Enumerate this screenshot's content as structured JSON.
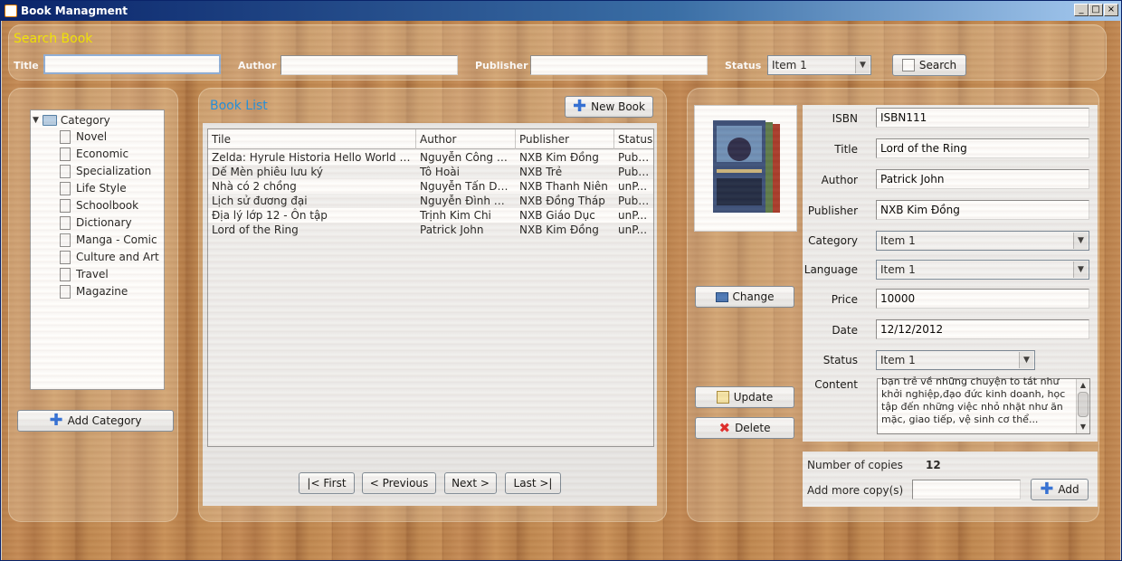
{
  "window": {
    "title": "Book Managment"
  },
  "search": {
    "heading": "Search Book",
    "title_label": "Title",
    "title_value": "",
    "author_label": "Author",
    "author_value": "",
    "publisher_label": "Publisher",
    "publisher_value": "",
    "status_label": "Status",
    "status_value": "Item 1",
    "search_button": "Search"
  },
  "category_tree": {
    "root": "Category",
    "items": [
      "Novel",
      "Economic",
      "Specialization",
      "Life Style",
      "Schoolbook",
      "Dictionary",
      "Manga - Comic",
      "Culture and Art",
      "Travel",
      "Magazine"
    ],
    "add_button": "Add Category"
  },
  "book_list": {
    "heading": "Book List",
    "new_button": "New Book",
    "columns": [
      "Tile",
      "Author",
      "Publisher",
      "Status"
    ],
    "rows": [
      [
        "Zelda: Hyrule Historia Hello World RD...",
        "Nguyễn Công H...",
        "NXB Kim Đồng",
        "Public"
      ],
      [
        "Dế Mèn phiêu lưu ký",
        "Tô Hoài",
        "NXB Trẻ",
        "Public"
      ],
      [
        "Nhà có 2 chồng",
        "Nguyễn Tấn Dũng",
        "NXB Thanh Niên",
        "unP..."
      ],
      [
        "Lịch sử đương đại",
        "Nguyễn Đình Ch...",
        "NXB Đồng Tháp",
        "Public"
      ],
      [
        "Địa lý lớp 12 - Ôn tập",
        "Trịnh Kim Chi",
        "NXB Giáo Dục",
        "unP..."
      ],
      [
        "Lord of the Ring",
        "Patrick John",
        "NXB Kim Đồng",
        "unP..."
      ]
    ],
    "pagination": {
      "first": "|< First",
      "previous": "< Previous",
      "next": "Next >",
      "last": "Last >|"
    }
  },
  "details": {
    "isbn_label": "ISBN",
    "isbn": "ISBN111",
    "title_label": "Title",
    "title": "Lord of the Ring",
    "author_label": "Author",
    "author": "Patrick John",
    "publisher_label": "Publisher",
    "publisher": "NXB Kim Đồng",
    "category_label": "Category",
    "category": "Item 1",
    "language_label": "Language",
    "language": "Item 1",
    "price_label": "Price",
    "price": "10000",
    "date_label": "Date",
    "date": "12/12/2012",
    "status_label": "Status",
    "status": "Item 1",
    "content_label": "Content",
    "content": "bạn trẻ về những chuyện to tát như khởi nghiệp,đạo đức kinh doanh, học tập đến những việc nhỏ nhặt như ăn mặc, giao tiếp, vệ sinh cơ thể...",
    "change_button": "Change",
    "update_button": "Update",
    "delete_button": "Delete",
    "copies_label": "Number of copies",
    "copies": "12",
    "add_copies_label": "Add more copy(s)",
    "add_copies_value": "",
    "add_button": "Add",
    "cover_text": "PHILIP PULLMAN · HIS DARK MATERIALS"
  }
}
